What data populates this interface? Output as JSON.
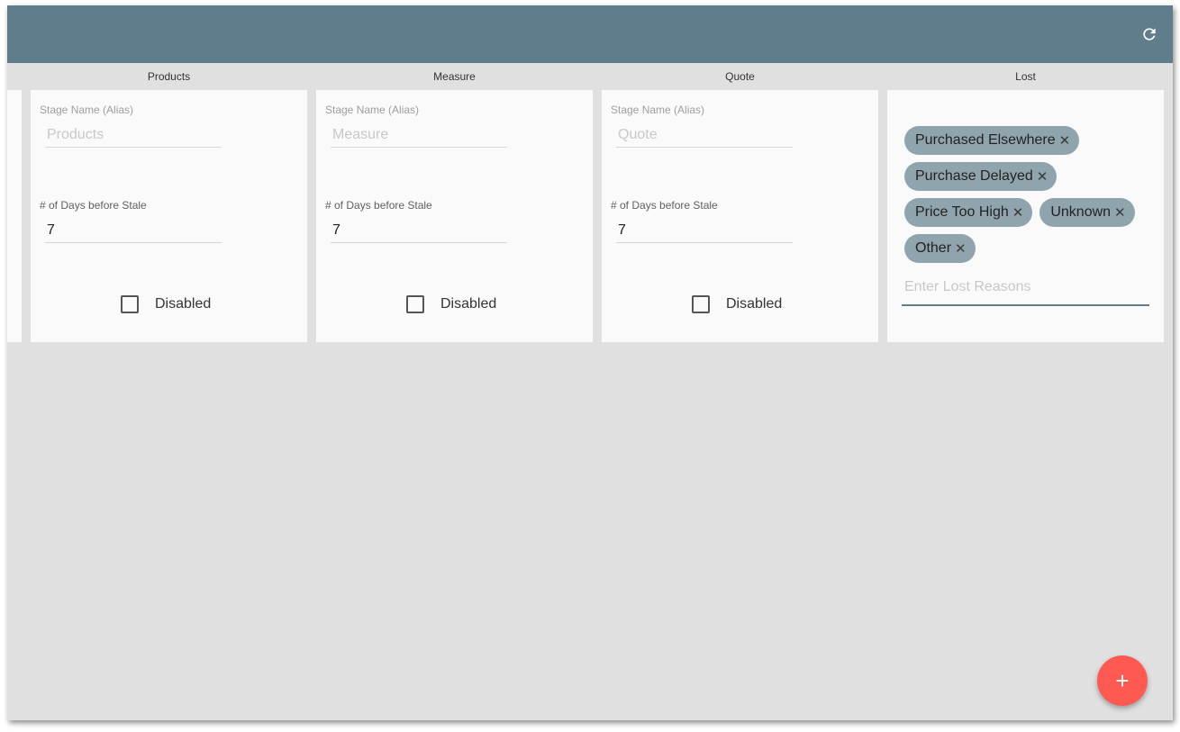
{
  "toolbar": {
    "refresh_icon": "refresh-icon"
  },
  "stages": [
    {
      "title": "Products",
      "alias_label": "Stage Name (Alias)",
      "alias_placeholder": "Products",
      "days_label": "# of Days before Stale",
      "days_value": "7",
      "disabled_label": "Disabled",
      "disabled_checked": false
    },
    {
      "title": "Measure",
      "alias_label": "Stage Name (Alias)",
      "alias_placeholder": "Measure",
      "days_label": "# of Days before Stale",
      "days_value": "7",
      "disabled_label": "Disabled",
      "disabled_checked": false
    },
    {
      "title": "Quote",
      "alias_label": "Stage Name (Alias)",
      "alias_placeholder": "Quote",
      "days_label": "# of Days before Stale",
      "days_value": "7",
      "disabled_label": "Disabled",
      "disabled_checked": false
    }
  ],
  "lost": {
    "title": "Lost",
    "reasons": [
      "Purchased Elsewhere",
      "Purchase Delayed",
      "Price Too High",
      "Unknown",
      "Other"
    ],
    "remove_glyph": "✕",
    "input_placeholder": "Enter Lost Reasons"
  },
  "fab": {
    "label": "+",
    "icon": "add-icon"
  },
  "colors": {
    "toolbar": "#607d8b",
    "chip": "#90a4ae",
    "fab": "#ff5a52",
    "background": "#e0e0e0",
    "card": "#fafafa"
  }
}
